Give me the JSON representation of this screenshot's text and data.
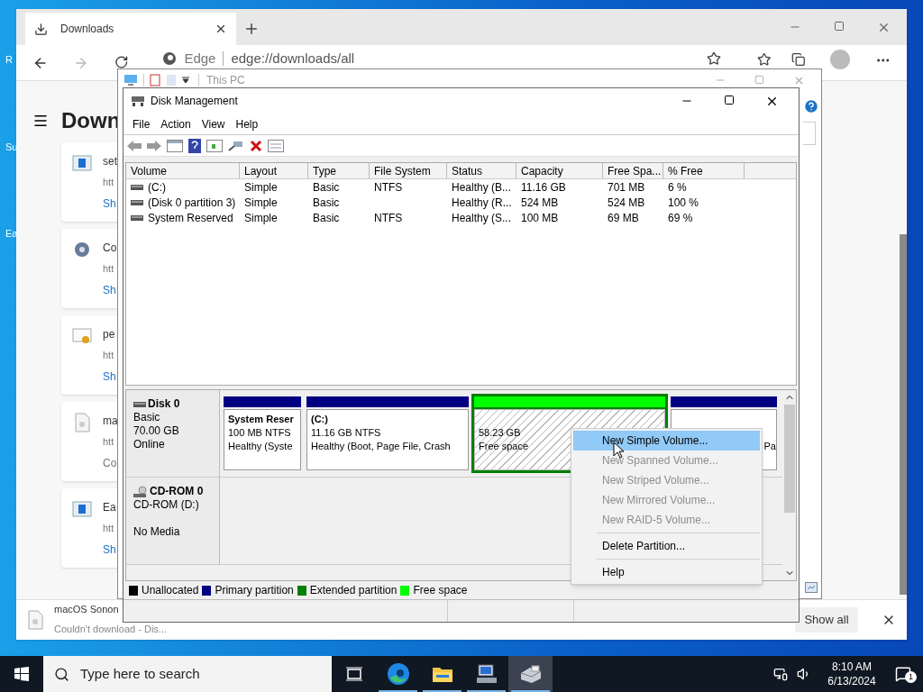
{
  "desktop": {
    "icon_labels": [
      "R",
      "Su",
      "Ea"
    ]
  },
  "browser": {
    "tab": {
      "label": "Downloads"
    },
    "address": {
      "site": "Edge",
      "url": "edge://downloads/all"
    },
    "page_title": "Down",
    "downloads": [
      {
        "kind": "installer",
        "name": "set",
        "url": "htt",
        "action": "Sh"
      },
      {
        "kind": "gear",
        "name": "Co",
        "url": "htt",
        "action": "Sh"
      },
      {
        "kind": "certificate",
        "name": "pe",
        "url": "htt",
        "action": "Sh"
      },
      {
        "kind": "blank",
        "name": "ma",
        "url": "htt",
        "action": "Co"
      },
      {
        "kind": "installer",
        "name": "Ea",
        "url": "htt",
        "action": "Sh"
      }
    ],
    "download_bar": {
      "file": "macOS Sonon",
      "status": "Couldn't download - Dis...",
      "show_all": "Show all"
    }
  },
  "explorer": {
    "title": "This PC"
  },
  "disk_management": {
    "title": "Disk Management",
    "menu": [
      "File",
      "Action",
      "View",
      "Help"
    ],
    "columns": [
      "Volume",
      "Layout",
      "Type",
      "File System",
      "Status",
      "Capacity",
      "Free Spa...",
      "% Free"
    ],
    "volumes": [
      {
        "cells": [
          "(C:)",
          "Simple",
          "Basic",
          "NTFS",
          "Healthy (B...",
          "11.16 GB",
          "701 MB",
          "6 %"
        ]
      },
      {
        "cells": [
          "(Disk 0 partition 3)",
          "Simple",
          "Basic",
          "",
          "Healthy (R...",
          "524 MB",
          "524 MB",
          "100 %"
        ]
      },
      {
        "cells": [
          "System Reserved",
          "Simple",
          "Basic",
          "NTFS",
          "Healthy (S...",
          "100 MB",
          "69 MB",
          "69 %"
        ]
      }
    ],
    "disks": [
      {
        "kind": "disk",
        "name": "Disk 0",
        "lines": [
          "Basic",
          "70.00 GB",
          "Online"
        ],
        "partitions": [
          {
            "kind": "primary",
            "selected": false,
            "title": "System Reser",
            "size": "100 MB NTFS",
            "status": "Healthy (Syste"
          },
          {
            "kind": "primary",
            "selected": false,
            "title": "(C:)",
            "size": "11.16 GB NTFS",
            "status": "Healthy (Boot, Page File, Crash"
          },
          {
            "kind": "free",
            "selected": true,
            "size": "58.23 GB",
            "status": "Free space"
          },
          {
            "kind": "primary",
            "selected": false,
            "status": "Pa"
          }
        ]
      },
      {
        "kind": "cdrom",
        "name": "CD-ROM 0",
        "lines": [
          "CD-ROM (D:)"
        ],
        "media": "No Media"
      }
    ],
    "legend": [
      {
        "label": "Unallocated",
        "color": "#000000"
      },
      {
        "label": "Primary partition",
        "color": "#000080"
      },
      {
        "label": "Extended partition",
        "color": "#008000"
      },
      {
        "label": "Free space",
        "color": "#00ff00"
      }
    ],
    "context_menu": [
      {
        "label": "New Simple Volume...",
        "selected": true,
        "disabled": false,
        "separator_before": false
      },
      {
        "label": "New Spanned Volume...",
        "selected": false,
        "disabled": true,
        "separator_before": false
      },
      {
        "label": "New Striped Volume...",
        "selected": false,
        "disabled": true,
        "separator_before": false
      },
      {
        "label": "New Mirrored Volume...",
        "selected": false,
        "disabled": true,
        "separator_before": false
      },
      {
        "label": "New RAID-5 Volume...",
        "selected": false,
        "disabled": true,
        "separator_before": false
      },
      {
        "label": "Delete Partition...",
        "selected": false,
        "disabled": false,
        "separator_before": true
      },
      {
        "label": "Help",
        "selected": false,
        "disabled": false,
        "separator_before": true
      }
    ]
  },
  "taskbar": {
    "search_placeholder": "Type here to search",
    "apps": [
      {
        "kind": "taskview",
        "running": false,
        "selected": false
      },
      {
        "kind": "edge",
        "running": true,
        "selected": false
      },
      {
        "kind": "explorer",
        "running": true,
        "selected": false
      },
      {
        "kind": "computer",
        "running": true,
        "selected": false
      },
      {
        "kind": "diskmgmt",
        "running": true,
        "selected": true
      }
    ],
    "time": "8:10 AM",
    "date": "6/13/2024",
    "notifications": "1"
  }
}
